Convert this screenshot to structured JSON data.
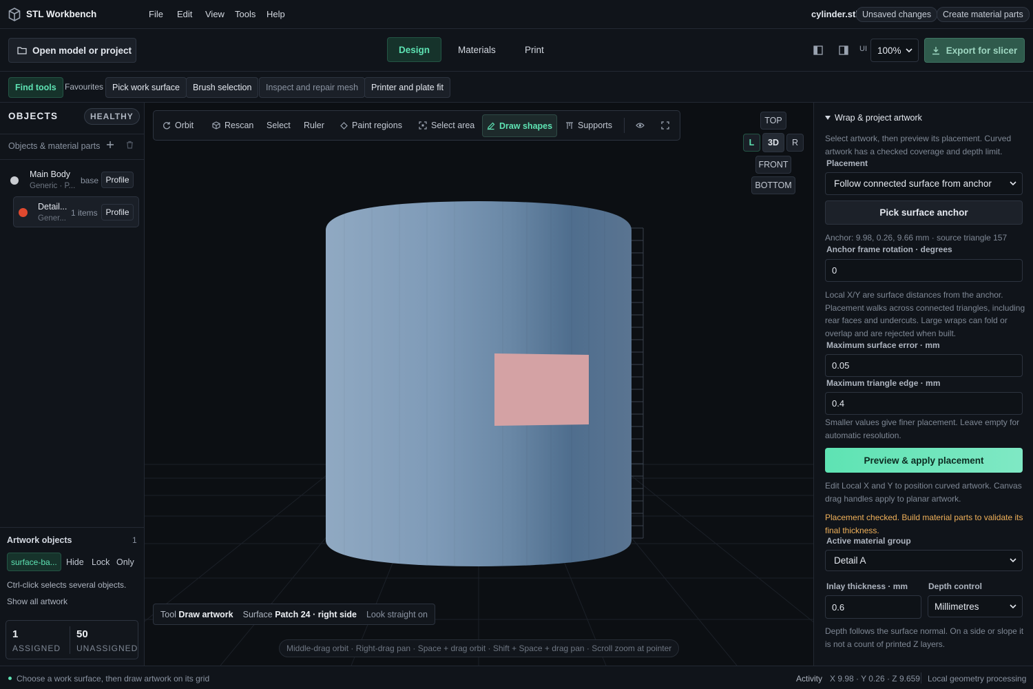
{
  "app": {
    "title": "STL Workbench"
  },
  "menu": [
    "File",
    "Edit",
    "View",
    "Tools",
    "Help"
  ],
  "file": {
    "name": "cylinder.stl",
    "status": "Unsaved changes",
    "create_button": "Create material parts"
  },
  "toolbar": {
    "open_label": "Open model or project",
    "tabs": [
      "Design",
      "Materials",
      "Print"
    ],
    "ui_label": "UI",
    "zoom": "100%",
    "export_label": "Export for slicer"
  },
  "toolstrip": {
    "find_tools": "Find tools",
    "favourites": "Favourites",
    "items": [
      "Pick work surface",
      "Brush selection",
      "Inspect and repair mesh",
      "Printer and plate fit"
    ]
  },
  "left": {
    "objects_title": "OBJECTS",
    "health": "HEALTHY",
    "parts_label": "Objects & material parts",
    "items": [
      {
        "name": "Main Body",
        "sub": "Generic · P...",
        "tag": "base",
        "profile": "Profile",
        "color": "#c9ccd1"
      },
      {
        "name": "Detail...",
        "sub": "Gener...",
        "tag": "1 items",
        "profile": "Profile",
        "color": "#e0492f"
      }
    ],
    "artwork_title": "Artwork objects",
    "artwork_count": "1",
    "artwork_chip": "surface-ba...",
    "artwork_actions": [
      "Hide",
      "Lock",
      "Only"
    ],
    "ctrl_hint": "Ctrl-click selects several objects.",
    "show_all": "Show all artwork",
    "assigned_value": "1",
    "assigned_label": "ASSIGNED",
    "unassigned_value": "50",
    "unassigned_label": "UNASSIGNED"
  },
  "viewport": {
    "tools": [
      "Orbit",
      "Rescan",
      "Select",
      "Ruler",
      "Paint regions",
      "Select area",
      "Draw shapes",
      "Supports"
    ],
    "views": {
      "top": "TOP",
      "left": "L",
      "threed": "3D",
      "right": "R",
      "front": "FRONT",
      "bottom": "BOTTOM"
    },
    "info": {
      "tool_label": "Tool",
      "tool_value": "Draw artwork",
      "surface_label": "Surface",
      "surface_value": "Patch 24 · right side",
      "look": "Look straight on"
    },
    "hint": "Middle-drag orbit · Right-drag pan · Space + drag orbit · Shift + Space + drag pan · Scroll zoom at pointer"
  },
  "right": {
    "section_title": "Wrap & project artwork",
    "intro": "Select artwork, then preview its placement. Curved artwork has a checked coverage and depth limit.",
    "placement_label": "Placement",
    "placement_value": "Follow connected surface from anchor",
    "pick_anchor": "Pick surface anchor",
    "anchor_info": "Anchor: 9.98, 0.26, 9.66 mm · source triangle 157",
    "rotation_label": "Anchor frame rotation · degrees",
    "rotation_value": "0",
    "local_help": "Local X/Y are surface distances from the anchor. Placement walks across connected triangles, including rear faces and undercuts. Large wraps can fold or overlap and are rejected when built.",
    "max_error_label": "Maximum surface error · mm",
    "max_error_value": "0.05",
    "max_edge_label": "Maximum triangle edge · mm",
    "max_edge_value": "0.4",
    "smaller_help": "Smaller values give finer placement. Leave empty for automatic resolution.",
    "preview_button": "Preview & apply placement",
    "edit_help": "Edit Local X and Y to position curved artwork. Canvas drag handles apply to planar artwork.",
    "warning": "Placement checked. Build material parts to validate its final thickness.",
    "material_label": "Active material group",
    "material_value": "Detail A",
    "inlay_label": "Inlay thickness · mm",
    "inlay_value": "0.6",
    "depth_label": "Depth control",
    "depth_value": "Millimetres",
    "depth_help": "Depth follows the surface normal. On a side or slope it is not a count of printed Z layers."
  },
  "status": {
    "message": "Choose a work surface, then draw artwork on its grid",
    "activity": "Activity",
    "coords": "X 9.98 · Y 0.26 · Z 9.659",
    "processing": "Local geometry processing"
  },
  "colors": {
    "accent": "#5ee3b3",
    "warning": "#f0b15a",
    "cylinder": "#7e9ab5",
    "patch": "#d4a2a4"
  }
}
